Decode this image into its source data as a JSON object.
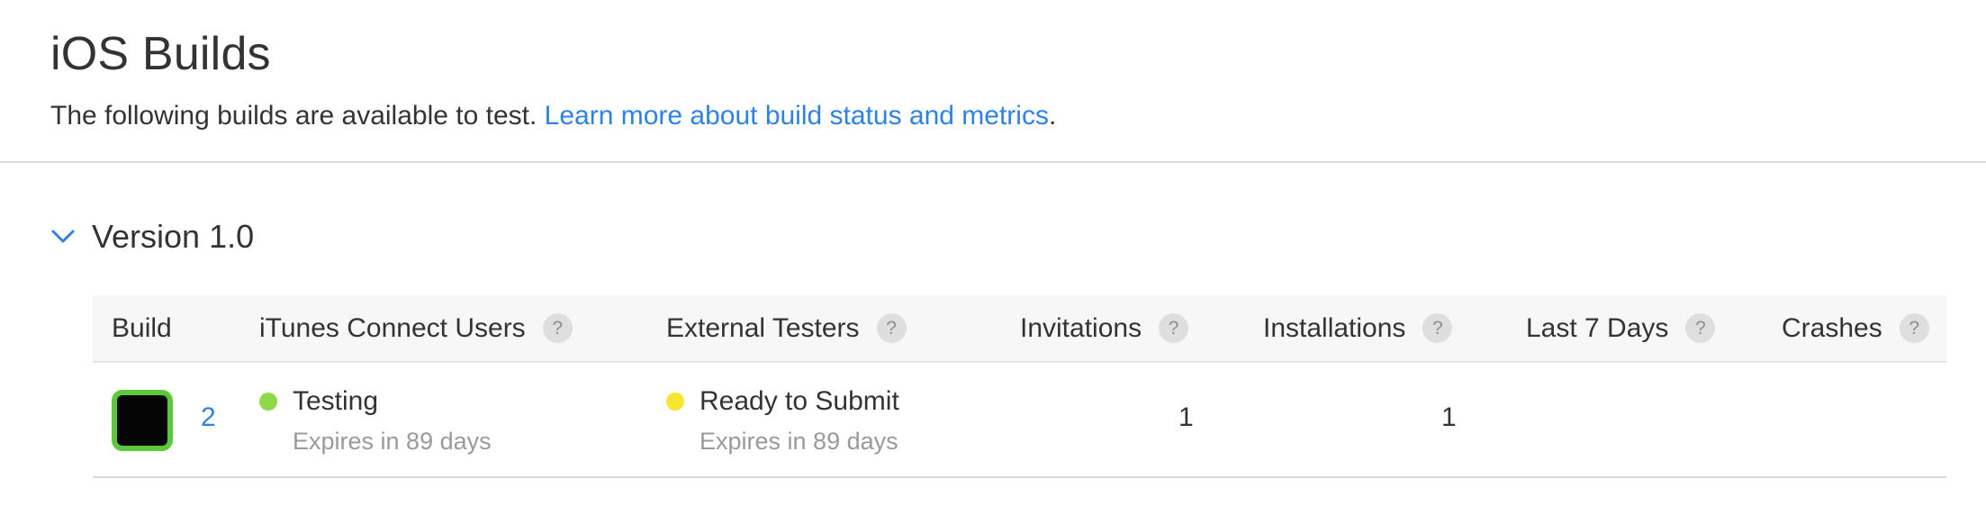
{
  "header": {
    "title": "iOS Builds",
    "subtitle_text": "The following builds are available to test. ",
    "subtitle_link": "Learn more about build status and metrics",
    "subtitle_end": "."
  },
  "version": {
    "label": "Version 1.0",
    "expanded": true,
    "chevron_icon": "chevron-down-icon"
  },
  "table": {
    "columns": [
      {
        "label": "Build",
        "help": false
      },
      {
        "label": "iTunes Connect Users",
        "help": true
      },
      {
        "label": "External Testers",
        "help": true
      },
      {
        "label": "Invitations",
        "help": true
      },
      {
        "label": "Installations",
        "help": true
      },
      {
        "label": "Last 7 Days",
        "help": true
      },
      {
        "label": "Crashes",
        "help": true
      }
    ],
    "help_glyph": "?",
    "rows": [
      {
        "build_number": "2",
        "itunes_status": "Testing",
        "itunes_expires": "Expires in 89 days",
        "external_status": "Ready to Submit",
        "external_expires": "Expires in 89 days",
        "invitations": "1",
        "installations": "1",
        "last_7_days": "",
        "crashes": ""
      }
    ]
  },
  "colors": {
    "link": "#2e82e6",
    "status_testing": "#8ed94a",
    "status_ready": "#f7e530",
    "app_icon_border": "#5cc83c"
  }
}
